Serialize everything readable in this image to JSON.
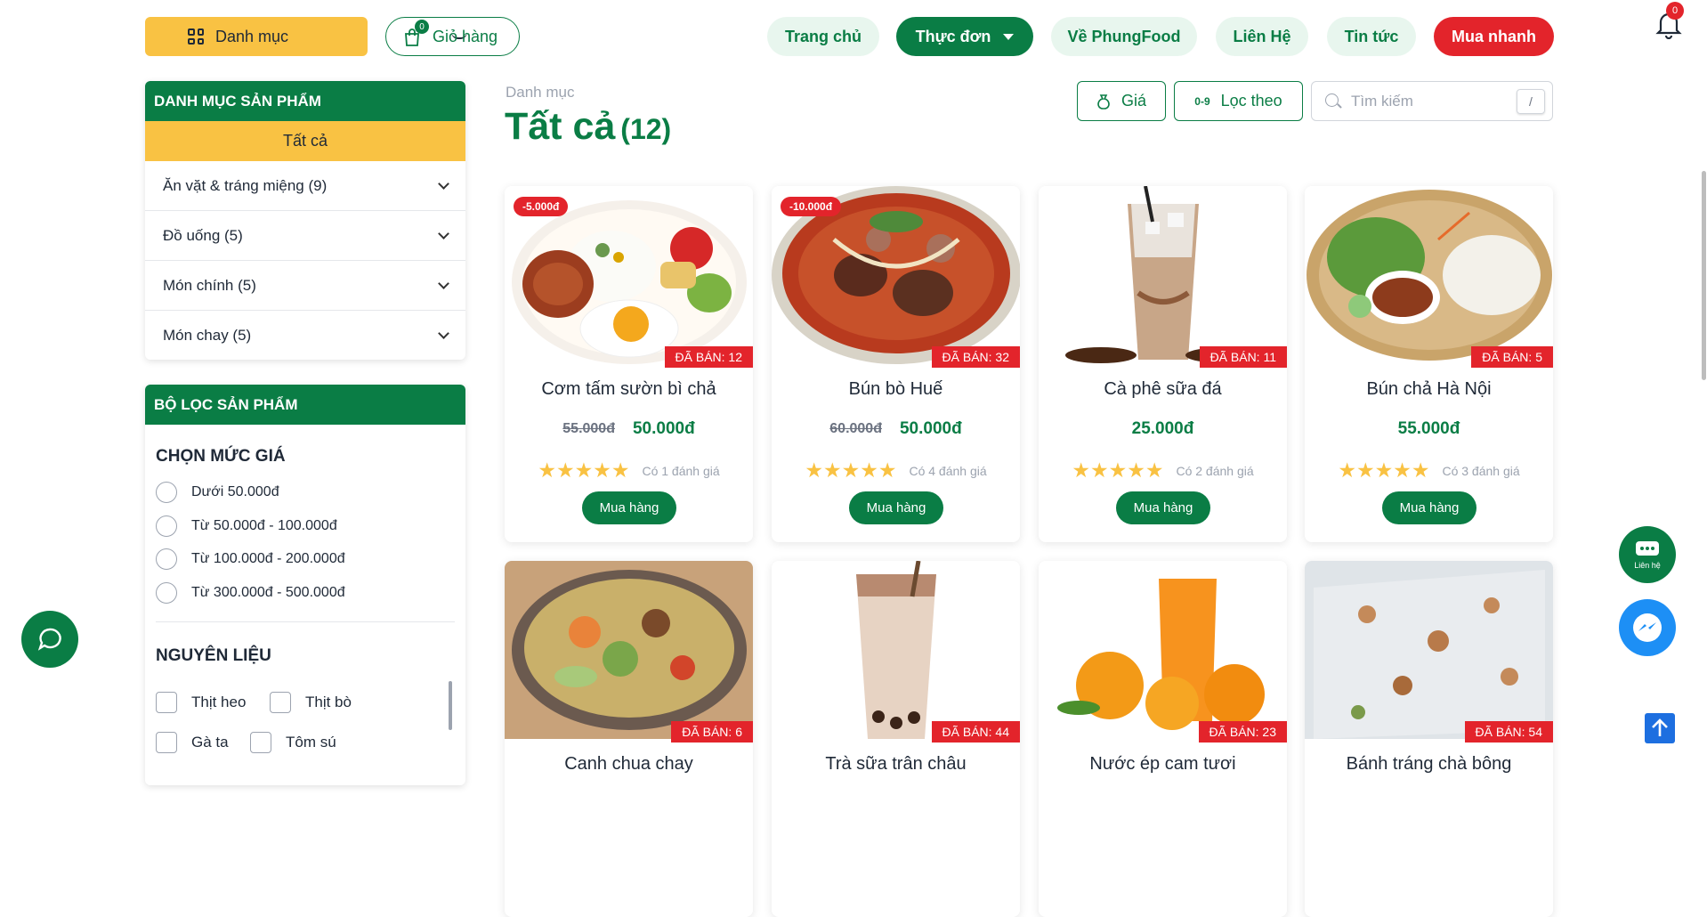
{
  "header": {
    "category_button": "Danh mục",
    "cart_label": "Giỏ hàng",
    "cart_count": "0",
    "nav": [
      "Trang chủ",
      "Thực đơn",
      "Về PhungFood",
      "Liên Hệ",
      "Tin tức",
      "Mua nhanh"
    ],
    "notification_count": "0"
  },
  "sidebar": {
    "category_title": "DANH MỤC SẢN PHẨM",
    "all_label": "Tất cả",
    "categories": [
      "Ăn vặt & tráng miệng (9)",
      "Đồ uống (5)",
      "Món chính (5)",
      "Món chay (5)"
    ],
    "filter_title": "BỘ LỌC SẢN PHẨM",
    "price_heading": "CHỌN MỨC GIÁ",
    "price_options": [
      "Dưới 50.000đ",
      "Từ 50.000đ - 100.000đ",
      "Từ 100.000đ - 200.000đ",
      "Từ 300.000đ - 500.000đ"
    ],
    "ingredient_heading": "NGUYÊN LIỆU",
    "ingredients": [
      "Thịt heo",
      "Thịt bò",
      "Gà ta",
      "Tôm sú"
    ]
  },
  "main": {
    "breadcrumb": "Danh mục",
    "title": "Tất cả",
    "count": "(12)",
    "price_button": "Giá",
    "sort_button": "Lọc theo",
    "sort_icon": "0-9",
    "search_placeholder": "Tìm kiếm",
    "search_shortcut": "/"
  },
  "products": [
    {
      "name": "Cơm tấm sườn bì chả",
      "discount": "-5.000đ",
      "sold": "ĐÃ BÁN: 12",
      "old_price": "55.000đ",
      "price": "50.000đ",
      "stars": "★★★★★",
      "reviews": "Có 1 đánh giá",
      "buy": "Mua hàng"
    },
    {
      "name": "Bún bò Huế",
      "discount": "-10.000đ",
      "sold": "ĐÃ BÁN: 32",
      "old_price": "60.000đ",
      "price": "50.000đ",
      "stars": "★★★★★",
      "reviews": "Có 4 đánh giá",
      "buy": "Mua hàng"
    },
    {
      "name": "Cà phê sữa đá",
      "discount": "",
      "sold": "ĐÃ BÁN: 11",
      "old_price": "",
      "price": "25.000đ",
      "stars": "★★★★★",
      "reviews": "Có 2 đánh giá",
      "buy": "Mua hàng"
    },
    {
      "name": "Bún chả Hà Nội",
      "discount": "",
      "sold": "ĐÃ BÁN: 5",
      "old_price": "",
      "price": "55.000đ",
      "stars": "★★★★★",
      "reviews": "Có 3 đánh giá",
      "buy": "Mua hàng"
    },
    {
      "name": "Canh chua chay",
      "sold": "ĐÃ BÁN: 6"
    },
    {
      "name": "Trà sữa trân châu",
      "sold": "ĐÃ BÁN: 44"
    },
    {
      "name": "Nước ép cam tươi",
      "sold": "ĐÃ BÁN: 23"
    },
    {
      "name": "Bánh tráng chà bông",
      "sold": "ĐÃ BÁN: 54"
    }
  ],
  "floating": {
    "contact_label": "Liên hệ"
  },
  "colors": {
    "primary": "#0a7d45",
    "accent": "#f9c243",
    "danger": "#e3242b",
    "messenger": "#1d8ff5"
  }
}
